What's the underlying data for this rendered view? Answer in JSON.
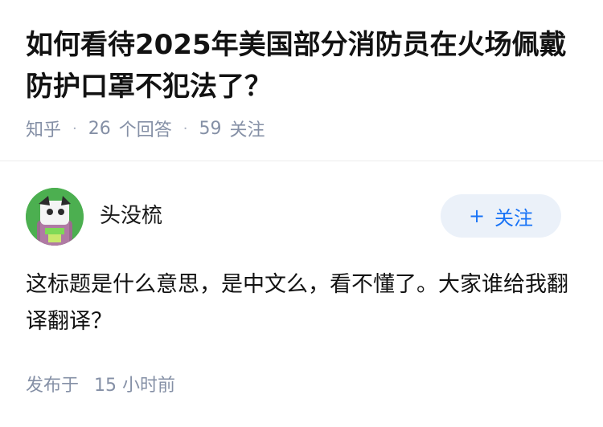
{
  "question": {
    "title": "如何看待2025年美国部分消防员在火场佩戴防护口罩不犯法了？",
    "source": "知乎",
    "answers_count": "26",
    "answers_label": "个回答",
    "followers_count": "59",
    "followers_label": "关注"
  },
  "answer": {
    "author_name": "头没梳",
    "avatar_icon": "cartoon-avatar-icon",
    "follow_button": {
      "plus": "+",
      "label": "关注"
    },
    "content": "这标题是什么意思，是中文么，看不懂了。大家谁给我翻译翻译？",
    "published_label": "发布于",
    "published_time": "15 小时前"
  },
  "colors": {
    "accent": "#1772f6",
    "follow_bg": "#ebf1f9",
    "meta_gray": "#8590a6",
    "avatar_green": "#4caf50"
  }
}
